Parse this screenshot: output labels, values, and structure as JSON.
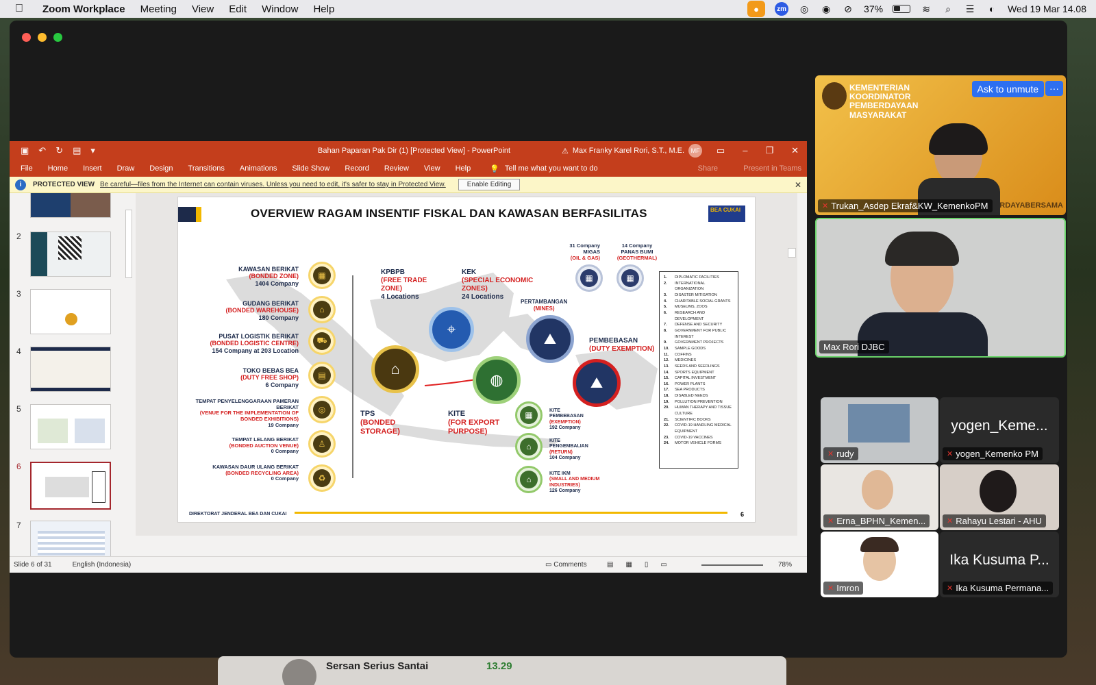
{
  "menubar": {
    "app_name": "Zoom Workplace",
    "items": [
      "Meeting",
      "View",
      "Edit",
      "Window",
      "Help"
    ],
    "battery": "37%",
    "clock": "Wed 19 Mar  14.08"
  },
  "ppt": {
    "doc_title": "Bahan Paparan Pak Dir (1) [Protected View]  -  PowerPoint",
    "user": "Max Franky Karel Rori, S.T., M.E.",
    "user_initials": "MF",
    "tabs": [
      "File",
      "Home",
      "Insert",
      "Draw",
      "Design",
      "Transitions",
      "Animations",
      "Slide Show",
      "Record",
      "Review",
      "View",
      "Help"
    ],
    "tell_me": "Tell me what you want to do",
    "share": "Share",
    "present_in_teams": "Present in Teams",
    "protected_label": "PROTECTED VIEW",
    "protected_msg": "Be careful—files from the Internet can contain viruses. Unless you need to edit, it's safer to stay in Protected View.",
    "enable_editing": "Enable Editing",
    "thumbnails": [
      "2",
      "3",
      "4",
      "5",
      "6",
      "7"
    ],
    "status_slide": "Slide 6 of 31",
    "status_lang": "English (Indonesia)",
    "status_comments": "Comments",
    "status_zoom": "78%"
  },
  "slide": {
    "title": "OVERVIEW RAGAM INSENTIF FISKAL DAN KAWASAN BERFASILITAS",
    "logo": "BEA CUKAI",
    "left_labels": [
      {
        "name": "KAWASAN BERIKAT",
        "sub": "(BONDED ZONE)",
        "count": "1404 Company"
      },
      {
        "name": "GUDANG BERIKAT",
        "sub": "(BONDED WAREHOUSE)",
        "count": "180 Company"
      },
      {
        "name": "PUSAT LOGISTIK BERIKAT",
        "sub": "(BONDED LOGISTIC CENTRE)",
        "count": "154 Company at 203 Location"
      },
      {
        "name": "TOKO BEBAS BEA",
        "sub": "(DUTY FREE SHOP)",
        "count": "6 Company"
      },
      {
        "name": "TEMPAT PENYELENGGARAAN PAMERAN BERIKAT",
        "sub": "(VENUE FOR THE IMPLEMENTATION OF BONDED EXHIBITIONS)",
        "count": "19 Company"
      },
      {
        "name": "TEMPAT LELANG BERIKAT",
        "sub": "(BONDED AUCTION VENUE)",
        "count": "0 Company"
      },
      {
        "name": "KAWASAN DAUR ULANG BERIKAT",
        "sub": "(BONDED RECYCLING AREA)",
        "count": "0 Company"
      }
    ],
    "kpbpb": {
      "name": "KPBPB",
      "sub": "(FREE TRADE ZONE)",
      "count": "4 Locations"
    },
    "kek": {
      "name": "KEK",
      "sub": "(SPECIAL ECONOMIC ZONES)",
      "count": "24 Locations"
    },
    "tps": {
      "name": "TPS",
      "sub": "(BONDED STORAGE)"
    },
    "kite": {
      "name": "KITE",
      "sub": "(FOR EXPORT PURPOSE)"
    },
    "pertambangan": {
      "name": "PERTAMBANGAN",
      "sub": "(MINES)"
    },
    "pembebasan": {
      "name": "PEMBEBASAN",
      "sub": "(DUTY EXEMPTION)"
    },
    "migas": {
      "count": "31 Company",
      "name": "MIGAS",
      "sub": "(OIL & GAS)"
    },
    "panas_bumi": {
      "count": "14 Company",
      "name": "PANAS BUMI",
      "sub": "(GEOTHERMAL)"
    },
    "kite_items": [
      {
        "name": "KITE PEMBEBASAN",
        "sub": "(EXEMPTION)",
        "count": "192 Company"
      },
      {
        "name": "KITE PENGEMBALIAN",
        "sub": "(RETURN)",
        "count": "104 Company"
      },
      {
        "name": "KITE IKM",
        "sub": "(SMALL AND MEDIUM INDUSTRIES)",
        "count": "126 Company"
      }
    ],
    "exemption_list": [
      "DIPLOMATIC FACILITIES",
      "INTERNATIONAL ORGANIZATION",
      "DISASTER MITIGATION",
      "CHARITABLE SOCIAL GRANTS",
      "MUSEUMS, ZOOS",
      "RESEARCH AND DEVELOPMENT",
      "DEFENSE AND SECURITY",
      "GOVERNMENT FOR PUBLIC INTEREST",
      "GOVERNMENT PROJECTS",
      "SAMPLE GOODS",
      "COFFINS",
      "MEDICINES",
      "SEEDS AND SEEDLINGS",
      "SPORTS EQUIPMENT",
      "CAPITAL INVESTMENT",
      "POWER PLANTS",
      "SEA PRODUCTS",
      "DISABLED NEEDS",
      "POLLUTION PREVENTION",
      "HUMAN THERAPY AND TISSUE CULTURE",
      "SCIENTIFIC BOOKS",
      "COVID-19 HANDLING MEDICAL EQUIPMENT",
      "COVID-19 VACCINES",
      "MOTOR VEHICLE FORMS"
    ],
    "footer": "DIREKTORAT JENDERAL  BEA DAN CUKAI",
    "number": "6"
  },
  "participants": {
    "ask_to_unmute": "Ask to unmute",
    "more": "···",
    "banner_org": "KEMENTERIAN KOORDINATOR PEMBERDAYAAN MASYARAKAT",
    "banner_tag": "ERDAYABERSAMA",
    "tiles": [
      {
        "name": "Trukan_Asdep Ekraf&KW_KemenkoPM"
      },
      {
        "name": "Max Rori DJBC"
      },
      {
        "name": "rudy"
      },
      {
        "name": "yogen_Kemenko PM",
        "big": "yogen_Keme..."
      },
      {
        "name": "Erna_BPHN_Kemen..."
      },
      {
        "name": "Rahayu Lestari - AHU"
      },
      {
        "name": "Imron"
      },
      {
        "name": "Ika Kusuma Permana...",
        "big": "Ika Kusuma P..."
      }
    ]
  },
  "bottom_strip": {
    "title": "Sersan Serius Santai",
    "time": "13.29"
  }
}
